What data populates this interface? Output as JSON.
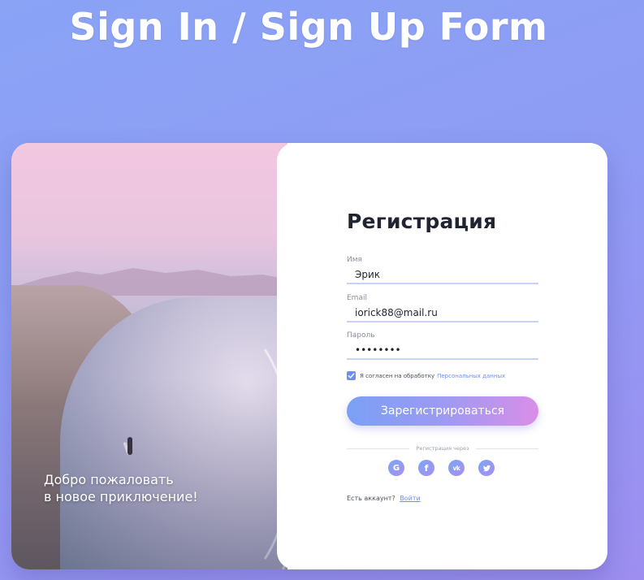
{
  "page": {
    "heading": "Sign In / Sign Up Form"
  },
  "photo": {
    "welcome_line1": "Добро пожаловать",
    "welcome_line2": "в новое приключение!"
  },
  "form": {
    "title": "Регистрация",
    "name": {
      "label": "Имя",
      "value": "Эрик"
    },
    "email": {
      "label": "Email",
      "value": "iorick88@mail.ru"
    },
    "password": {
      "label": "Пароль",
      "value": "12345678"
    },
    "consent": {
      "checked": true,
      "text": "Я согласен на обработку",
      "link": "Персональных данных"
    },
    "submit_label": "Зарегистрироваться",
    "divider_text": "Регистрация через",
    "socials": [
      {
        "name": "google-icon",
        "glyph": "G"
      },
      {
        "name": "facebook-icon",
        "glyph": "f"
      },
      {
        "name": "vk-icon",
        "glyph": "vk"
      },
      {
        "name": "twitter-icon",
        "glyph": "twitter"
      }
    ],
    "login_prompt": "Есть аккаунт?",
    "login_link": "Войти"
  },
  "colors": {
    "accent": "#6e8ef1",
    "button_gradient_start": "#7aa0f5",
    "button_gradient_end": "#d98ee8",
    "background_start": "#8aa3f5",
    "background_end": "#9d8ef0"
  }
}
